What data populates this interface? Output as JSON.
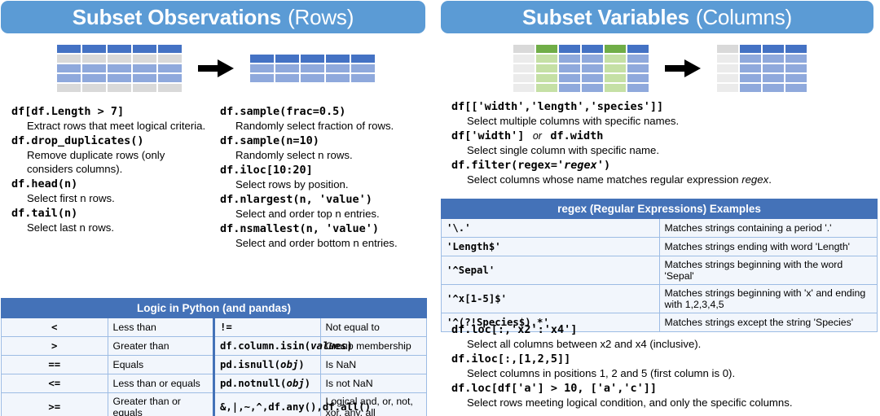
{
  "left": {
    "banner": {
      "bold": "Subset Observations",
      "light": "(Rows)"
    },
    "diagram": {
      "source_name": "source-table-diagram",
      "result_name": "result-table-diagram",
      "arrow_name": "arrow-right-icon"
    },
    "code_col1": [
      {
        "code": "df[df.Length > 7]",
        "desc": "Extract rows that meet logical criteria."
      },
      {
        "code": "df.drop_duplicates()",
        "desc": "Remove duplicate rows (only considers columns)."
      },
      {
        "code": "df.head(n)",
        "desc": "Select first n rows."
      },
      {
        "code": "df.tail(n)",
        "desc": "Select last n rows."
      }
    ],
    "code_col2": [
      {
        "code": "df.sample(frac=0.5)",
        "desc": "Randomly select fraction of rows."
      },
      {
        "code": "df.sample(n=10)",
        "desc": "Randomly select n rows."
      },
      {
        "code": "df.iloc[10:20]",
        "desc": "Select rows by position."
      },
      {
        "code": "df.nlargest(n, 'value')",
        "desc": "Select and order top n entries."
      },
      {
        "code": "df.nsmallest(n, 'value')",
        "desc": "Select and order bottom n entries."
      }
    ],
    "logic_table": {
      "title": "Logic in Python (and pandas)",
      "rows": [
        {
          "op": "<",
          "meaning": "Less than",
          "op2": "!=",
          "meaning2": "Not equal to"
        },
        {
          "op": ">",
          "meaning": "Greater than",
          "op2": "df.column.isin(values)",
          "meaning2": "Group membership"
        },
        {
          "op": "==",
          "meaning": "Equals",
          "op2": "pd.isnull(obj)",
          "meaning2": "Is NaN"
        },
        {
          "op": "<=",
          "meaning": "Less than or equals",
          "op2": "pd.notnull(obj)",
          "meaning2": "Is not NaN"
        },
        {
          "op": ">=",
          "meaning": "Greater than or equals",
          "op2": "&,|,~,^,df.any(),df.all()",
          "meaning2": "Logical and, or, not, xor, any, all"
        }
      ]
    }
  },
  "right": {
    "banner": {
      "bold": "Subset Variables",
      "light": "(Columns)"
    },
    "diagram": {
      "source_name": "source-columns-diagram",
      "result_name": "result-columns-diagram",
      "arrow_name": "arrow-right-icon"
    },
    "code_top": [
      {
        "code": "df[['width','length','species']]",
        "desc": "Select multiple columns with specific names."
      },
      {
        "code": "df['width']   or   df.width",
        "desc": "Select single column with specific name."
      },
      {
        "code": "df.filter(regex='regex')",
        "desc": "Select columns whose name matches regular expression regex."
      }
    ],
    "regex_table": {
      "title": "regex (Regular Expressions) Examples",
      "rows": [
        {
          "pattern": "'\\.'",
          "meaning": "Matches strings containing a period '.'"
        },
        {
          "pattern": "'Length$'",
          "meaning": "Matches strings ending with word 'Length'"
        },
        {
          "pattern": "'^Sepal'",
          "meaning": "Matches strings beginning with the word 'Sepal'"
        },
        {
          "pattern": "'^x[1-5]$'",
          "meaning": "Matches strings beginning with 'x' and ending with 1,2,3,4,5"
        },
        {
          "pattern": "'^(?!Species$).*'",
          "meaning": "Matches strings except the string 'Species'"
        }
      ]
    },
    "code_bottom": [
      {
        "code": "df.loc[:,'x2':'x4']",
        "desc": "Select all columns between x2 and x4 (inclusive)."
      },
      {
        "code": "df.iloc[:,[1,2,5]]",
        "desc": "Select columns in positions 1, 2 and 5 (first column is 0)."
      },
      {
        "code": "df.loc[df['a'] > 10, ['a','c']]",
        "desc": "Select rows meeting logical condition, and only the specific columns."
      }
    ]
  },
  "colors": {
    "banner_blue": "#5b9bd5",
    "table_header_blue": "#4472b8",
    "cell_dark_blue": "#4472c4",
    "cell_light_blue": "#8fa9dc",
    "cell_gray": "#d9d9d9",
    "cell_light_gray": "#ebebeb",
    "cell_green": "#70ad47",
    "cell_light_green": "#c5e0a5",
    "row_bg": "#f2f6fc",
    "border": "#9dbce4"
  }
}
